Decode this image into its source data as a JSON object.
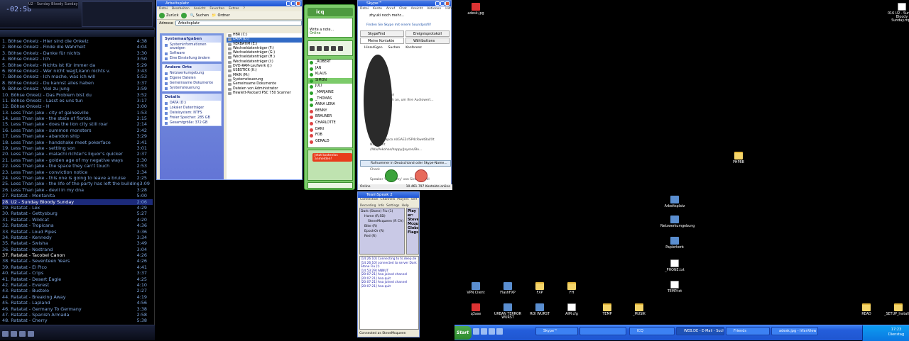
{
  "winamp": {
    "time": "-02:58",
    "track_title": "U2 - Sunday Bloody Sunday",
    "playlist": [
      {
        "t": "1. Böhse Onkelz - Hier sind die Onkelz",
        "d": "4:38"
      },
      {
        "t": "2. Böhse Onkelz - Finde die Wahrheit",
        "d": "4:04"
      },
      {
        "t": "3. Böhse Onkelz - Danke für nichts",
        "d": "3:30"
      },
      {
        "t": "4. Böhse Onkelz - Ich",
        "d": "3:50"
      },
      {
        "t": "5. Böhse Onkelz - Nichts ist für immer da",
        "d": "5:29"
      },
      {
        "t": "6. Böhse Onkelz - Wer nicht wagt,kann nichts v.",
        "d": "3:43"
      },
      {
        "t": "7. Böhse Onkelz - Ich mache, was ich will",
        "d": "5:53"
      },
      {
        "t": "8. Böhse Onkelz - Du kannst alles haben",
        "d": "3:37"
      },
      {
        "t": "9. Böhse Onkelz - Viel zu jung",
        "d": "3:59"
      },
      {
        "t": "10. Böhse Onkelz - Das Problem bist du",
        "d": "3:52"
      },
      {
        "t": "11. Böhse Onkelz - Lasst es uns tun",
        "d": "3:17"
      },
      {
        "t": "12. Böhse Onkelz - H",
        "d": "3:00"
      },
      {
        "t": "13. Less Than Jake - city of gainesville",
        "d": "1:53"
      },
      {
        "t": "14. Less Than Jake - the state of florida",
        "d": "2:15"
      },
      {
        "t": "15. Less Than Jake - does the lion city still roar",
        "d": "2:14"
      },
      {
        "t": "16. Less Than Jake - summon monsters",
        "d": "2:42"
      },
      {
        "t": "17. Less Than Jake - abandon ship",
        "d": "3:29"
      },
      {
        "t": "18. Less Than Jake - handshake meet pokerface",
        "d": "2:41"
      },
      {
        "t": "19. Less Than Jake - settling son",
        "d": "3:01"
      },
      {
        "t": "20. Less Than Jake - malachi richter's liquor's quicker",
        "d": "2:37"
      },
      {
        "t": "21. Less Than Jake - golden age of my negative ways",
        "d": "2:30"
      },
      {
        "t": "22. Less Than Jake - the space they can't touch",
        "d": "2:53"
      },
      {
        "t": "23. Less Than Jake - conviction notice",
        "d": "2:34"
      },
      {
        "t": "24. Less Than Jake - this one is going to leave a bruise",
        "d": "2:25"
      },
      {
        "t": "25. Less Than Jake - the life of the party has left the building",
        "d": "3:09"
      },
      {
        "t": "26. Less Than Jake - devil in my dna",
        "d": "3:28"
      },
      {
        "t": "27. Ratatat - Montanita",
        "d": "5:00"
      },
      {
        "t": "28. U2 - Sunday Bloody Sunday",
        "d": "2:06",
        "cur": true
      },
      {
        "t": "29. Ratatat - Lex",
        "d": "4:29"
      },
      {
        "t": "30. Ratatat - Gettysburg",
        "d": "5:27"
      },
      {
        "t": "31. Ratatat - Wildcat",
        "d": "4:20"
      },
      {
        "t": "32. Ratatat - Tropicana",
        "d": "4:36"
      },
      {
        "t": "33. Ratatat - Loud Pipes",
        "d": "3:36"
      },
      {
        "t": "34. Ratatat - Kennedy",
        "d": "3:34"
      },
      {
        "t": "35. Ratatat - Swisha",
        "d": "3:49"
      },
      {
        "t": "36. Ratatat - Nostrand",
        "d": "3:04"
      },
      {
        "t": "37. Ratatat - Tacobel Canon",
        "d": "4:26",
        "hl": true
      },
      {
        "t": "38. Ratatat - Seventeen Years",
        "d": "4:26"
      },
      {
        "t": "39. Ratatat - El Pico",
        "d": "4:41"
      },
      {
        "t": "40. Ratatat - Crips",
        "d": "3:37"
      },
      {
        "t": "41. Ratatat - Desert Eagle",
        "d": "4:25"
      },
      {
        "t": "42. Ratatat - Everest",
        "d": "4:10"
      },
      {
        "t": "43. Ratatat - Bustelo",
        "d": "2:27"
      },
      {
        "t": "44. Ratatat - Breaking Away",
        "d": "4:19"
      },
      {
        "t": "45. Ratatat - Lapland",
        "d": "4:56"
      },
      {
        "t": "46. Ratatat - Germany To Germany",
        "d": "3:38"
      },
      {
        "t": "47. Ratatat - Spanish Armada",
        "d": "2:58"
      },
      {
        "t": "48. Ratatat - Cherry",
        "d": "5:38"
      }
    ]
  },
  "explorer": {
    "title": "Arbeitsplatz",
    "menu": [
      "Datei",
      "Bearbeiten",
      "Ansicht",
      "Favoriten",
      "Extras",
      "?"
    ],
    "back": "Zurück",
    "search": "Suchen",
    "folders": "Ordner",
    "address_label": "Adresse",
    "address": "Arbeitsplatz",
    "panels": [
      {
        "title": "Systemaufgaben",
        "items": [
          "Systeminformationen anzeigen",
          "Software",
          "Eine Einstellung ändern"
        ]
      },
      {
        "title": "Andere Orte",
        "items": [
          "Netzwerkumgebung",
          "Eigene Dateien",
          "Gemeinsame Dokumente",
          "Systemsteuerung"
        ]
      },
      {
        "title": "Details",
        "items": [
          "DATA (D:)",
          "Lokaler Datenträger",
          "Dateisystem: NTFS",
          "Freier Speicher: 285 GB",
          "Gesamtgröße: 372 GB"
        ]
      }
    ],
    "drives": [
      "HBR (C:)",
      "DATA (D:)",
      "VERBATIM (E:)",
      "Wechseldatenträger (F:)",
      "Wechseldatenträger (G:)",
      "Wechseldatenträger (H:)",
      "Wechseldatenträger (I:)",
      "DVD-RAM-Laufwerk (J:)",
      "USBSTICK (K:)",
      "MAIN (M:)",
      "Systemsteuerung",
      "Gemeinsame Dokumente",
      "Dateien von Administrator",
      "Hewlett-Packard PSC 750 Scanner"
    ]
  },
  "icq": {
    "title": "icq",
    "status_msg": "Write a note...",
    "status": "Online",
    "contacts": [
      "_ROBERT",
      "JAN",
      "KLAUS",
      "SIMON",
      "JULI",
      "_MARJAINE",
      "_THOMAS",
      "ANNA LENA",
      "BENNY",
      "BRAUNER",
      "CHARLOTTE",
      "DANI",
      "FOB",
      "GERALD"
    ],
    "ad": "Jetzt kostenlos anmelden!"
  },
  "skype": {
    "title": "Skype™",
    "menu": [
      "Datei",
      "Konto",
      "Anruf",
      "Chat",
      "Ansicht",
      "Aktionen",
      "Hilfe"
    ],
    "mood": "zhyuki noch mehr...",
    "promo": "Finden Sie Skype mit einem Soundprofil!",
    "tabs": [
      "SkypeFind",
      "Ereignisprotokoll",
      "Meine Kontakte",
      "Wählbuttons"
    ],
    "tools": [
      "Hinzufügen",
      "Suchen",
      "Konferenz"
    ],
    "lines": [
      "",
      "",
      "",
      "",
      "",
      "",
      "",
      "",
      "verkehr (leave)",
      "Bilder Sie mich an, um Ihre Audiowert...",
      "",
      "",
      "",
      "",
      "",
      "",
      "",
      "//videos.zapco.nl/GAE2r/SP4cRwetBal/Xt",
      "Nachricht",
      "//Wa/Pekohas/happy/Jayson/Bo...",
      "",
      "",
      "",
      "Check",
      "",
      "Speaker 'Fred Army' von Sick Of It All",
      ""
    ],
    "input": "Rufnummer in Deutschland oder Skype-Name...",
    "status": "Online",
    "online_count": "10.461.797 Kontakte online"
  },
  "teamspeak": {
    "title": "TeamSpeak 2",
    "menu": [
      "Connection",
      "Channels",
      "Players",
      "Self",
      "Recording",
      "Info",
      "Settings",
      "Help"
    ],
    "tree": [
      "Dark (Stone) Flu (1)",
      "Home (R,SD)",
      "SteveMcqueen (R CA)",
      "Bike (R)",
      "EpochOr (R)",
      "Red (R)"
    ],
    "info": "Play er: Steve Mcqueen Global Flags",
    "log": [
      "[14:26:10] Connecting to ts.deep.de",
      "[14:26:10] connected to server Dark Stone Flu (!)",
      "[14:53:29] ANNUT",
      "[20:07:21] Ana joined channel",
      "[20:07:21] Ana quit",
      "[20:07:21] Ana joined channel",
      "[20:07:21] Ana quit"
    ],
    "status": "Connected as SteveMcqueen"
  },
  "desktop": {
    "icons": [
      {
        "label": "adesk.jpg",
        "kind": "red"
      },
      {
        "label": "016 U2 - Sunday Bloody Sunday.mp3",
        "kind": "doc"
      },
      {
        "label": "PHPBB",
        "kind": "fold"
      },
      {
        "label": "Arbeitsplatz",
        "kind": "app"
      },
      {
        "label": "Netzwerkumgebung",
        "kind": "app"
      },
      {
        "label": "Papierkorb",
        "kind": "app"
      },
      {
        "label": "_PHONE.txt",
        "kind": "doc"
      },
      {
        "label": "TEMP.txt",
        "kind": "doc"
      },
      {
        "label": "VPN Client",
        "kind": "app"
      },
      {
        "label": "FlashFXP",
        "kind": "app"
      },
      {
        "label": "FXP",
        "kind": "fold"
      },
      {
        "label": "FH",
        "kind": "fold"
      },
      {
        "label": "q3ase",
        "kind": "red"
      },
      {
        "label": "URBAN TERROR WURST",
        "kind": "app"
      },
      {
        "label": "ROI WURST",
        "kind": "app"
      },
      {
        "label": "AIM.cfg",
        "kind": "doc"
      },
      {
        "label": "TEMP",
        "kind": "fold"
      },
      {
        "label": "_MUSIK",
        "kind": "fold"
      },
      {
        "label": "READ",
        "kind": "fold"
      },
      {
        "label": "_SETUP_Installer",
        "kind": "fold"
      }
    ]
  },
  "taskbar": {
    "start": "Start",
    "tasks": [
      "Skype™",
      "",
      "Arbeitsplatz",
      "ICQ",
      "WEB.DE - E-Mail - Sucho...",
      "Friends",
      "adesk.jpg - IrfanView"
    ],
    "time": "17:23",
    "day": "Dienstag"
  }
}
